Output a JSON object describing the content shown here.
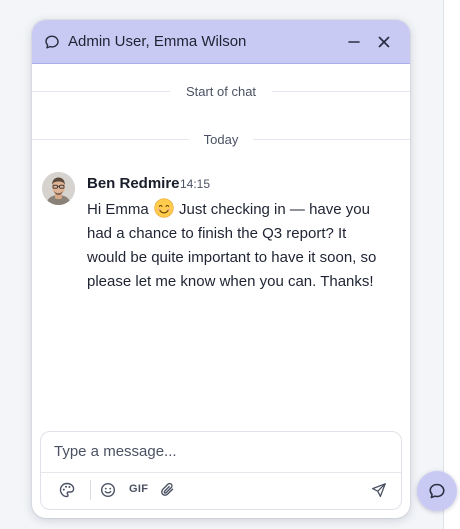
{
  "header": {
    "title": "Admin User, Emma Wilson",
    "icon": "chat-bubble-icon",
    "background": "#c8caf4"
  },
  "dividers": {
    "start_label": "Start of chat",
    "today_label": "Today"
  },
  "message": {
    "sender": "Ben Redmire",
    "time": "14:15",
    "text_before_emoji": "Hi Emma",
    "emoji": "smiling-face-emoji",
    "text_after_emoji": "Just checking in — have you had a chance to finish the Q3 report? It would be quite important to have it soon, so please let me know when you can. Thanks!"
  },
  "composer": {
    "placeholder": "Type a message...",
    "value": "",
    "tools": [
      "palette-icon",
      "emoji-icon",
      "gif",
      "attachment-icon"
    ],
    "gif_label": "GIF",
    "send_icon": "send-icon"
  },
  "launcher": {
    "icon": "chat-bubble-icon",
    "background": "#c8caf4"
  }
}
